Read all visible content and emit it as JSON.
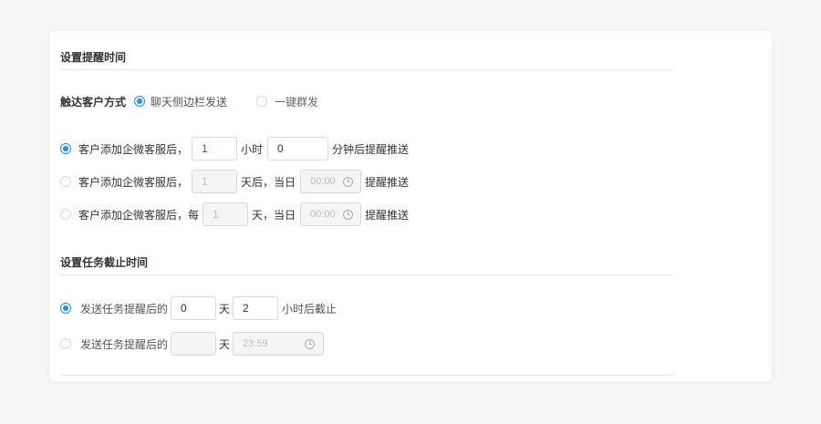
{
  "remind_section": {
    "title": "设置提醒时间",
    "reach_label": "触达客户方式",
    "reach_options": [
      {
        "label": "聊天侧边栏发送",
        "selected": true
      },
      {
        "label": "一键群发",
        "selected": false
      }
    ],
    "rules": [
      {
        "selected": true,
        "prefix": "客户添加企微客服后，",
        "hours_value": "1",
        "hours_unit": "小时",
        "minutes_value": "0",
        "suffix": "分钟后提醒推送"
      },
      {
        "selected": false,
        "prefix": "客户添加企微客服后，",
        "days_value": "1",
        "days_unit": "天后，当日",
        "time_value": "00:00",
        "suffix": "提醒推送"
      },
      {
        "selected": false,
        "prefix": "客户添加企微客服后，每",
        "days_value": "1",
        "days_unit": "天，当日",
        "time_value": "00:00",
        "suffix": "提醒推送"
      }
    ]
  },
  "deadline_section": {
    "title": "设置任务截止时间",
    "options": [
      {
        "selected": true,
        "prefix": "发送任务提醒后的",
        "days_value": "0",
        "days_unit": "天",
        "hours_value": "2",
        "suffix": "小时后截止"
      },
      {
        "selected": false,
        "prefix": "发送任务提醒后的",
        "days_value": "",
        "days_unit": "天",
        "time_value": "23:59"
      }
    ]
  },
  "colors": {
    "accent": "#1890ff",
    "border": "#d9d9d9",
    "disabled_bg": "#f5f5f5",
    "page_bg": "#f5f6f7"
  },
  "icons": [
    "radio-checked",
    "radio-unchecked",
    "clock-icon"
  ]
}
